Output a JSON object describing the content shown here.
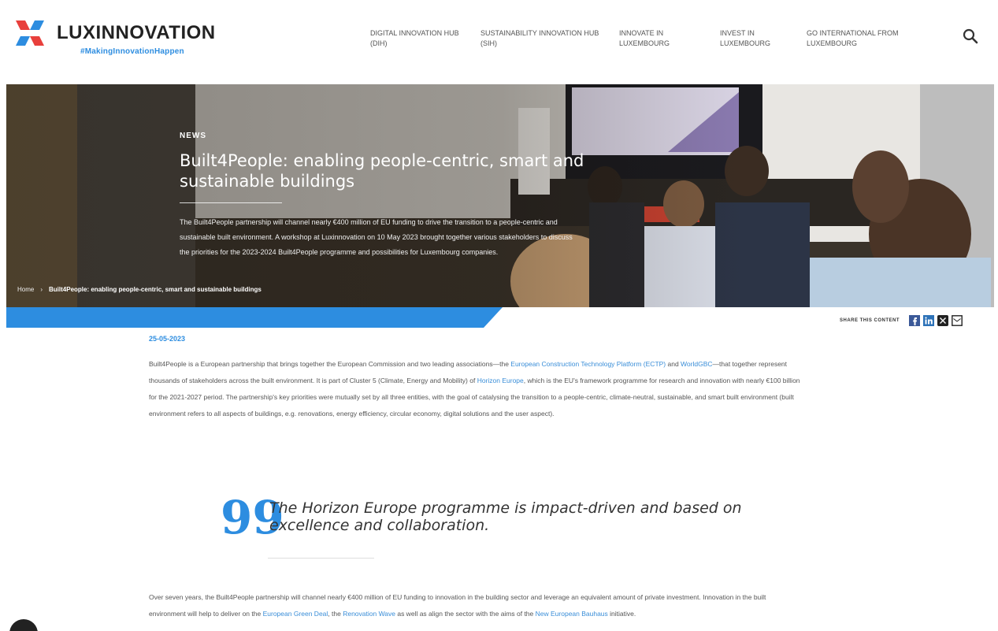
{
  "header": {
    "logo_text": "LUXINNOVATION",
    "logo_tagline": "#MakingInnovationHappen",
    "nav": [
      "Digital innovation hub (DIH)",
      "Sustainability innovation hub (SIH)",
      "Innovate in Luxembourg",
      "Invest in Luxembourg",
      "Go international from Luxembourg"
    ],
    "search_icon": "search-icon"
  },
  "hero": {
    "kicker": "NEWS",
    "title": "Built4People: enabling people-centric, smart and sustainable buildings",
    "summary": "The Built4People partnership will channel nearly €400 million of EU funding to drive the transition to a people-centric and sustainable built environment. A workshop at Luxinnovation on 10 May 2023 brought together various stakeholders to discuss the priorities for the 2023-2024 Built4People programme and possibilities for Luxembourg companies.",
    "breadcrumb": {
      "home": "Home",
      "separator": "›",
      "current": "Built4People: enabling people-centric, smart and sustainable buildings"
    }
  },
  "share": {
    "label": "SHARE THIS CONTENT",
    "icons": [
      "facebook-icon",
      "linkedin-icon",
      "x-icon",
      "email-icon"
    ]
  },
  "article": {
    "date": "25-05-2023",
    "para1": {
      "t1": "Built4People is a European partnership that brings together the European Commission and two leading associations—the ",
      "l1": "European Construction Technology Platform (ECTP)",
      "t2": " and ",
      "l2": "WorldGBC",
      "t3": "—that together represent thousands of stakeholders across the built environment. It is part of Cluster 5 (Climate, Energy and Mobility) of ",
      "l3": "Horizon Europe",
      "t4": ", which is the EU's framework programme for research and innovation with nearly €100 billion for the 2021-2027 period. The partnership's key priorities were mutually set by all three entities, with the goal of catalysing the transition to a people-centric, climate-neutral, sustainable, and smart built environment (built environment refers to all aspects of buildings, e.g. renovations, energy efficiency, circular economy, digital solutions and the user aspect)."
    },
    "quote_mark": "99",
    "quote": "The Horizon Europe programme is impact-driven and based on excellence and collaboration.",
    "para2": {
      "t1": "Over seven years, the Built4People partnership will channel nearly €400 million of EU funding to innovation in the building sector and leverage an equivalent amount of private investment. Innovation in the built environment will help to deliver on the ",
      "l1": "European Green Deal",
      "t2": ", the ",
      "l2": "Renovation Wave",
      "t3": " as well as align the sector with the aims of the ",
      "l3": "New European Bauhaus",
      "t4": " initiative."
    }
  },
  "colors": {
    "accent": "#2d8de0",
    "logo_red": "#e8403c",
    "logo_blue": "#2d8de0"
  }
}
